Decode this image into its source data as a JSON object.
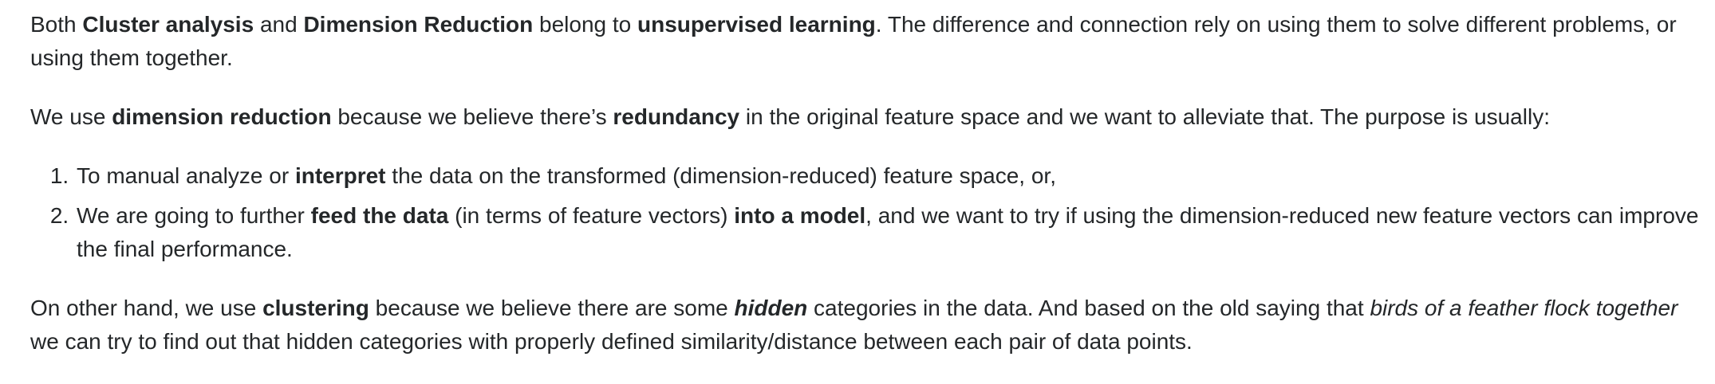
{
  "para1": {
    "t1": "Both ",
    "b1": "Cluster analysis",
    "t2": " and ",
    "b2": "Dimension Reduction",
    "t3": " belong to ",
    "b3": "unsupervised learning",
    "t4": ". The difference and connection rely on using them to solve different problems, or using them together."
  },
  "para2": {
    "t1": "We use ",
    "b1": "dimension reduction",
    "t2": " because we believe there’s ",
    "b2": "redundancy",
    "t3": " in the original feature space and we want to alleviate that. The purpose is usually:"
  },
  "list": {
    "item1": {
      "t1": "To manual analyze or ",
      "b1": "interpret",
      "t2": " the data on the transformed (dimension-reduced) feature space, or,"
    },
    "item2": {
      "t1": "We are going to further ",
      "b1": "feed the data",
      "t2": " (in terms of feature vectors) ",
      "b2": "into a model",
      "t3": ", and we want to try if using the dimension-reduced new feature vectors can improve the final performance."
    }
  },
  "para3": {
    "t1": "On other hand, we use ",
    "b1": "clustering",
    "t2": " because we believe there are some ",
    "bi1": "hidden",
    "t3": " categories in the data. And based on the old saying that ",
    "i1": "birds of a feather flock together",
    "t4": " we can try to find out that hidden categories with properly defined similarity/distance between each pair of data points."
  }
}
